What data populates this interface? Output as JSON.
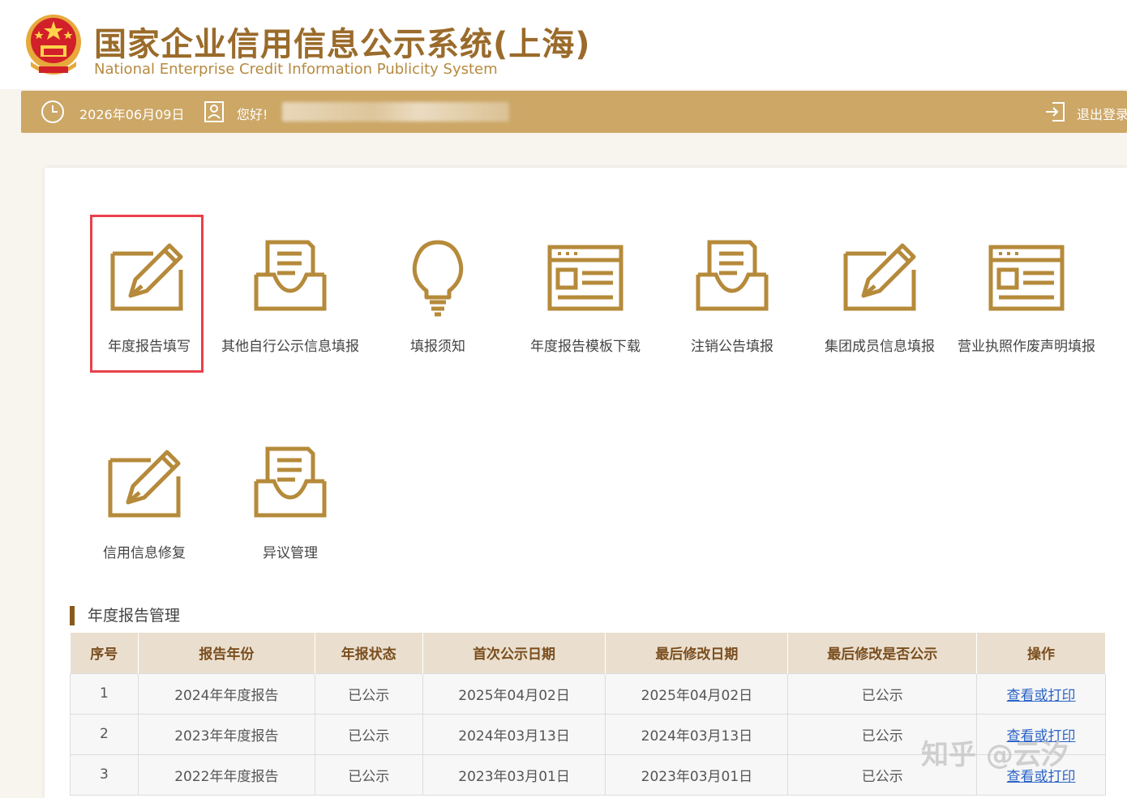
{
  "header": {
    "title": "国家企业信用信息公示系统(上海)",
    "subtitle": "National Enterprise Credit Information Publicity System"
  },
  "topbar": {
    "date": "2026年06月09日",
    "greeting": "您好!",
    "logout_label": "退出登录"
  },
  "tiles": [
    {
      "label": "年度报告填写",
      "icon": "edit-pencil-icon",
      "selected": true
    },
    {
      "label": "其他自行公示信息填报",
      "icon": "inbox-document-icon"
    },
    {
      "label": "填报须知",
      "icon": "lightbulb-icon"
    },
    {
      "label": "年度报告模板下载",
      "icon": "template-window-icon"
    },
    {
      "label": "注销公告填报",
      "icon": "inbox-document-icon"
    },
    {
      "label": "集团成员信息填报",
      "icon": "edit-pencil-icon"
    },
    {
      "label": "营业执照作废声明填报",
      "icon": "template-window-icon"
    },
    {
      "label": "信用信息修复",
      "icon": "edit-pencil-icon"
    },
    {
      "label": "异议管理",
      "icon": "inbox-document-icon"
    }
  ],
  "section": {
    "title": "年度报告管理"
  },
  "table": {
    "headers": [
      "序号",
      "报告年份",
      "年报状态",
      "首次公示日期",
      "最后修改日期",
      "最后修改是否公示",
      "操作"
    ],
    "rows": [
      [
        "1",
        "2024年年度报告",
        "已公示",
        "2025年04月02日",
        "2025年04月02日",
        "已公示",
        "查看或打印"
      ],
      [
        "2",
        "2023年年度报告",
        "已公示",
        "2024年03月13日",
        "2024年03月13日",
        "已公示",
        "查看或打印"
      ],
      [
        "3",
        "2022年年度报告",
        "已公示",
        "2023年03月01日",
        "2023年03月01日",
        "已公示",
        "查看或打印"
      ]
    ]
  },
  "watermark": "知乎 @云汐",
  "colors": {
    "brand_gold": "#cca766",
    "title_brown": "#9a6b2b",
    "icon_gold": "#b58a3a",
    "selected_border": "#e8414b",
    "link_blue": "#2b63c6"
  }
}
